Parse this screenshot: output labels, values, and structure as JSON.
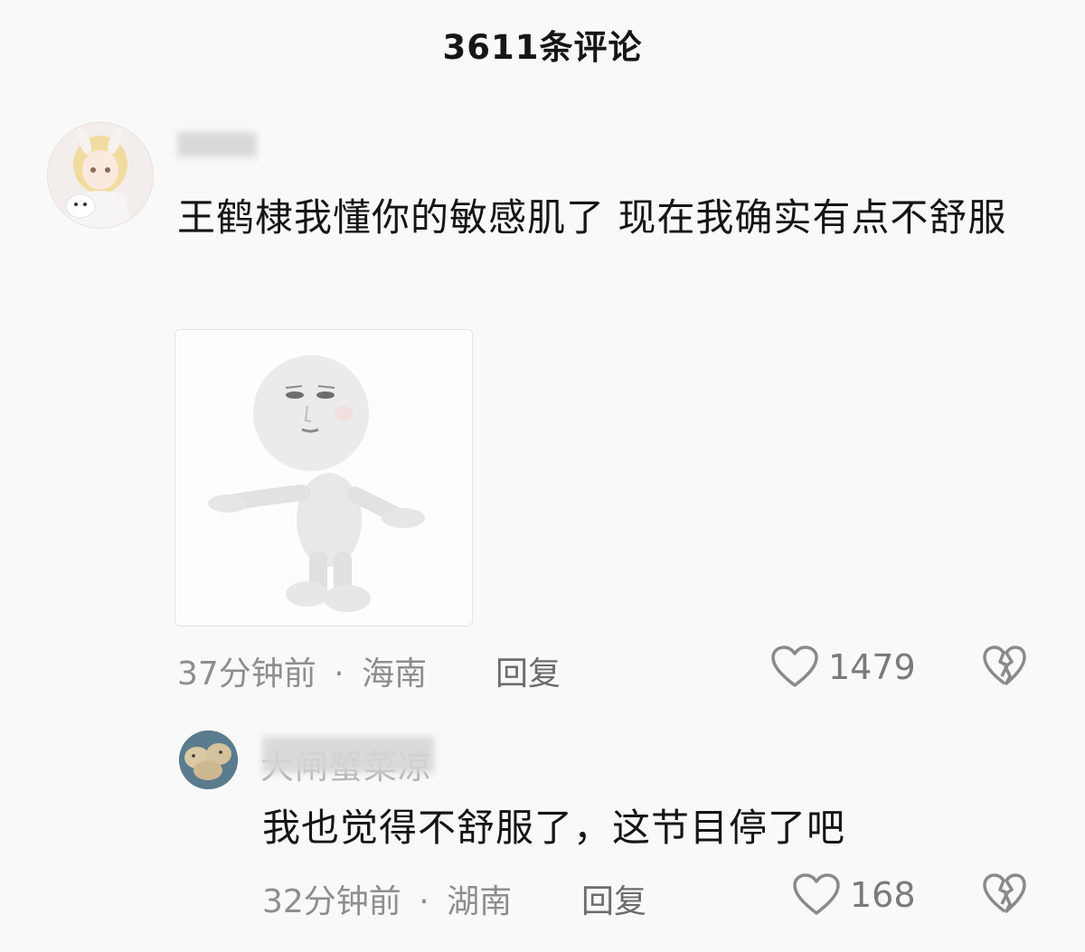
{
  "header": {
    "title": "3611条评论"
  },
  "comment": {
    "username_visible": "八",
    "text": "王鹤棣我懂你的敏感肌了 现在我确实有点不舒服",
    "image_alt": "meme-character-shrugging",
    "time": "37分钟前",
    "separator": "·",
    "location": "海南",
    "reply_label": "回复",
    "likes": "1479",
    "like_icon": "heart-outline-icon",
    "dislike_icon": "broken-heart-icon"
  },
  "reply": {
    "username_visible": "大闸蟹菜凉",
    "text": "我也觉得不舒服了，这节目停了吧",
    "time": "32分钟前",
    "separator": "·",
    "location": "湖南",
    "reply_label": "回复",
    "likes": "168",
    "like_icon": "heart-outline-icon",
    "dislike_icon": "broken-heart-icon"
  },
  "colors": {
    "background": "#f9f9f9",
    "text_primary": "#151515",
    "text_meta": "#8e8e8e"
  }
}
